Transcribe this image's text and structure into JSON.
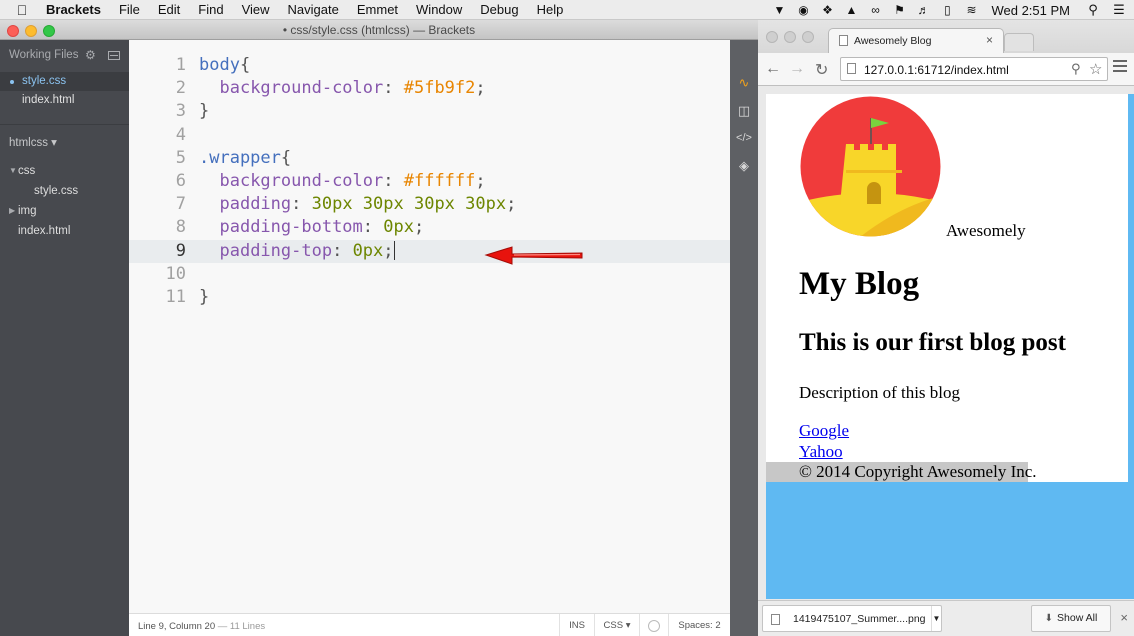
{
  "menubar": {
    "apple_icon": "apple-icon",
    "app_name": "Brackets",
    "menus": [
      "File",
      "Edit",
      "Find",
      "View",
      "Navigate",
      "Emmet",
      "Window",
      "Debug",
      "Help"
    ],
    "tray_icons": [
      "bell-icon",
      "record-icon",
      "dropbox-icon",
      "drive-icon",
      "creative-cloud-icon",
      "notifications-icon",
      "volume-icon",
      "battery-icon",
      "wifi-icon"
    ],
    "clock": "Wed 2:51 PM",
    "search_icon": "search-icon",
    "list_icon": "list-icon"
  },
  "brackets": {
    "window_title": "• css/style.css (htmlcss) — Brackets",
    "sidebar": {
      "working_files_label": "Working Files",
      "working_files": [
        {
          "name": "style.css",
          "selected": true
        },
        {
          "name": "index.html",
          "selected": false
        }
      ],
      "project_name": "htmlcss ▾",
      "tree": [
        {
          "name": "css",
          "type": "folder",
          "expanded": true,
          "level": 0
        },
        {
          "name": "style.css",
          "type": "file",
          "level": 1
        },
        {
          "name": "img",
          "type": "folder",
          "expanded": false,
          "level": 0
        },
        {
          "name": "index.html",
          "type": "file",
          "level": 0
        }
      ]
    },
    "editor": {
      "active_line": 9,
      "lines": [
        {
          "n": "1",
          "tokens": [
            [
              "sel",
              "body"
            ],
            [
              "br",
              "{"
            ]
          ]
        },
        {
          "n": "2",
          "tokens": [
            [
              "pun",
              "  "
            ],
            [
              "prop",
              "background-color"
            ],
            [
              "pun",
              ": "
            ],
            [
              "hex",
              "#5fb9f2"
            ],
            [
              "pun",
              ";"
            ]
          ]
        },
        {
          "n": "3",
          "tokens": [
            [
              "br",
              "}"
            ]
          ]
        },
        {
          "n": "4",
          "tokens": []
        },
        {
          "n": "5",
          "tokens": [
            [
              "sel",
              ".wrapper"
            ],
            [
              "br",
              "{"
            ]
          ]
        },
        {
          "n": "6",
          "tokens": [
            [
              "pun",
              "  "
            ],
            [
              "prop",
              "background-color"
            ],
            [
              "pun",
              ": "
            ],
            [
              "hex",
              "#ffffff"
            ],
            [
              "pun",
              ";"
            ]
          ]
        },
        {
          "n": "7",
          "tokens": [
            [
              "pun",
              "  "
            ],
            [
              "prop",
              "padding"
            ],
            [
              "pun",
              ": "
            ],
            [
              "val",
              "30px 30px 30px 30px"
            ],
            [
              "pun",
              ";"
            ]
          ]
        },
        {
          "n": "8",
          "tokens": [
            [
              "pun",
              "  "
            ],
            [
              "prop",
              "padding-bottom"
            ],
            [
              "pun",
              ": "
            ],
            [
              "val",
              "0px"
            ],
            [
              "pun",
              ";"
            ]
          ]
        },
        {
          "n": "9",
          "tokens": [
            [
              "pun",
              "  "
            ],
            [
              "prop",
              "padding-top"
            ],
            [
              "pun",
              ": "
            ],
            [
              "val",
              "0px"
            ],
            [
              "pun",
              ";"
            ]
          ]
        },
        {
          "n": "10",
          "tokens": []
        },
        {
          "n": "11",
          "tokens": [
            [
              "br",
              "}"
            ]
          ]
        }
      ]
    },
    "status": {
      "position": "Line 9, Column 20",
      "lines_count": "— 11 Lines",
      "mode": "INS",
      "language": "CSS ▾",
      "spaces": "Spaces: 2"
    },
    "toolbar_icons": [
      "live-preview-icon",
      "extension-manager-icon",
      "code-icon",
      "layers-icon"
    ],
    "annotation_arrow_color": "#e8130d"
  },
  "chrome": {
    "tab_title": "Awesomely Blog",
    "url": "127.0.0.1:61712/index.html",
    "page": {
      "logo_text": "Awesomely",
      "h1": "My Blog",
      "h2": "This is our first blog post",
      "description": "Description of this blog",
      "links": [
        "Google",
        "Yahoo"
      ],
      "footer": "© 2014 Copyright Awesomely Inc."
    },
    "download": {
      "file": "1419475107_Summer....png",
      "show_all": "Show All"
    },
    "colors": {
      "body_bg": "#5fb9f2",
      "wrapper_bg": "#ffffff",
      "logo_red": "#f03b3b",
      "logo_yellow": "#f8d629"
    }
  }
}
